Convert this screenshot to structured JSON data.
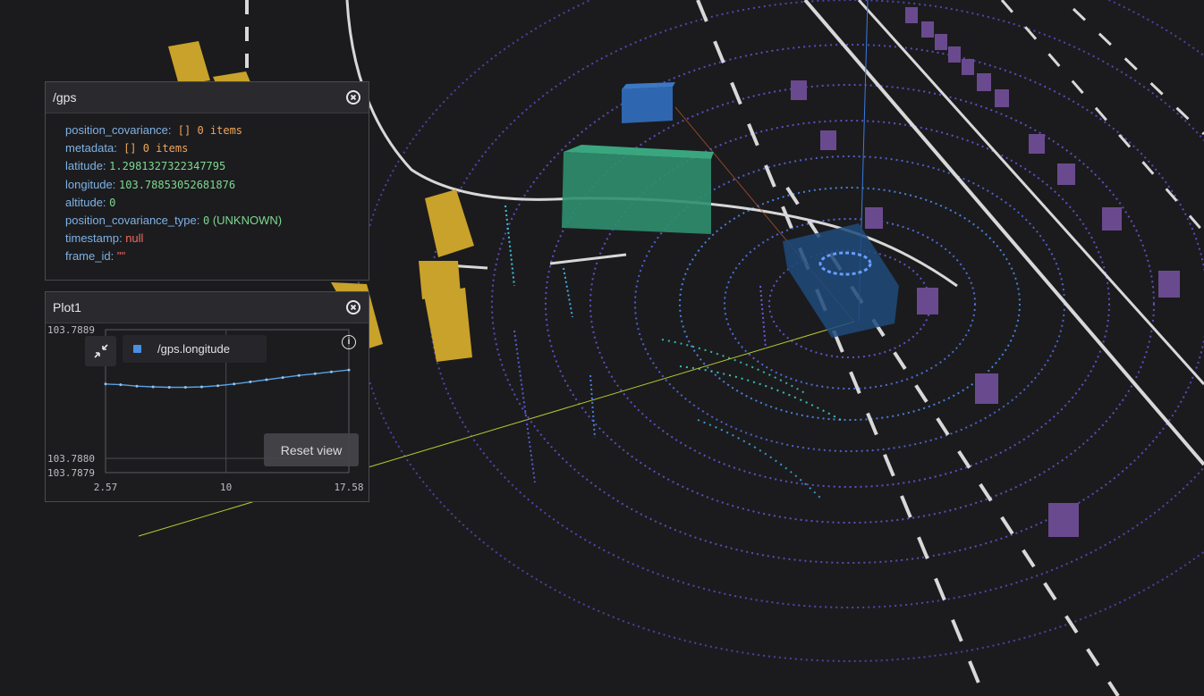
{
  "gps_panel": {
    "title": "/gps",
    "fields": {
      "position_covariance": {
        "key": "position_covariance:",
        "value": "[]  0 items"
      },
      "metadata": {
        "key": "metadata:",
        "value": "[]  0 items"
      },
      "latitude": {
        "key": "latitude:",
        "value": "1.2981327322347795"
      },
      "longitude": {
        "key": "longitude:",
        "value": "103.78853052681876"
      },
      "altitude": {
        "key": "altitude:",
        "value": "0"
      },
      "position_covariance_type": {
        "key": "position_covariance_type:",
        "value": "0",
        "enum": "(UNKNOWN)"
      },
      "timestamp": {
        "key": "timestamp:",
        "value": "null"
      },
      "frame_id": {
        "key": "frame_id:",
        "value": "\"\""
      }
    }
  },
  "plot_panel": {
    "title": "Plot1",
    "legend_label": "/gps.longitude",
    "reset_label": "Reset view",
    "icons": {
      "collapse": "collapse-arrows-icon",
      "info": "info-icon",
      "close": "close-icon"
    }
  },
  "chart_data": {
    "type": "line",
    "series": [
      {
        "name": "/gps.longitude",
        "color": "#5aa0e0",
        "x": [
          2.57,
          3.5,
          4.5,
          5.5,
          6.5,
          7.5,
          8.5,
          9.5,
          10.5,
          11.5,
          12.5,
          13.5,
          14.5,
          15.5,
          16.5,
          17.58
        ],
        "y": [
          103.78852,
          103.788515,
          103.788505,
          103.7885,
          103.788497,
          103.788497,
          103.7885,
          103.788508,
          103.78852,
          103.788535,
          103.78855,
          103.788565,
          103.78858,
          103.788592,
          103.788605,
          103.788618
        ]
      }
    ],
    "x_ticks": [
      "2.57",
      "10",
      "17.58"
    ],
    "y_ticks": [
      "103.7889",
      "103.7880",
      "103.7879"
    ],
    "xlim": [
      2.57,
      17.58
    ],
    "ylim": [
      103.7879,
      103.7889
    ],
    "grid": true
  },
  "scene": {
    "background": "#1b1b1d",
    "truck_color": "#2f8f6f",
    "car_blue": "#2f66b0",
    "ego_color": "#1e4a7a",
    "cone_color": "#c8a22a",
    "pedestrian_color": "#6a4a8e"
  }
}
